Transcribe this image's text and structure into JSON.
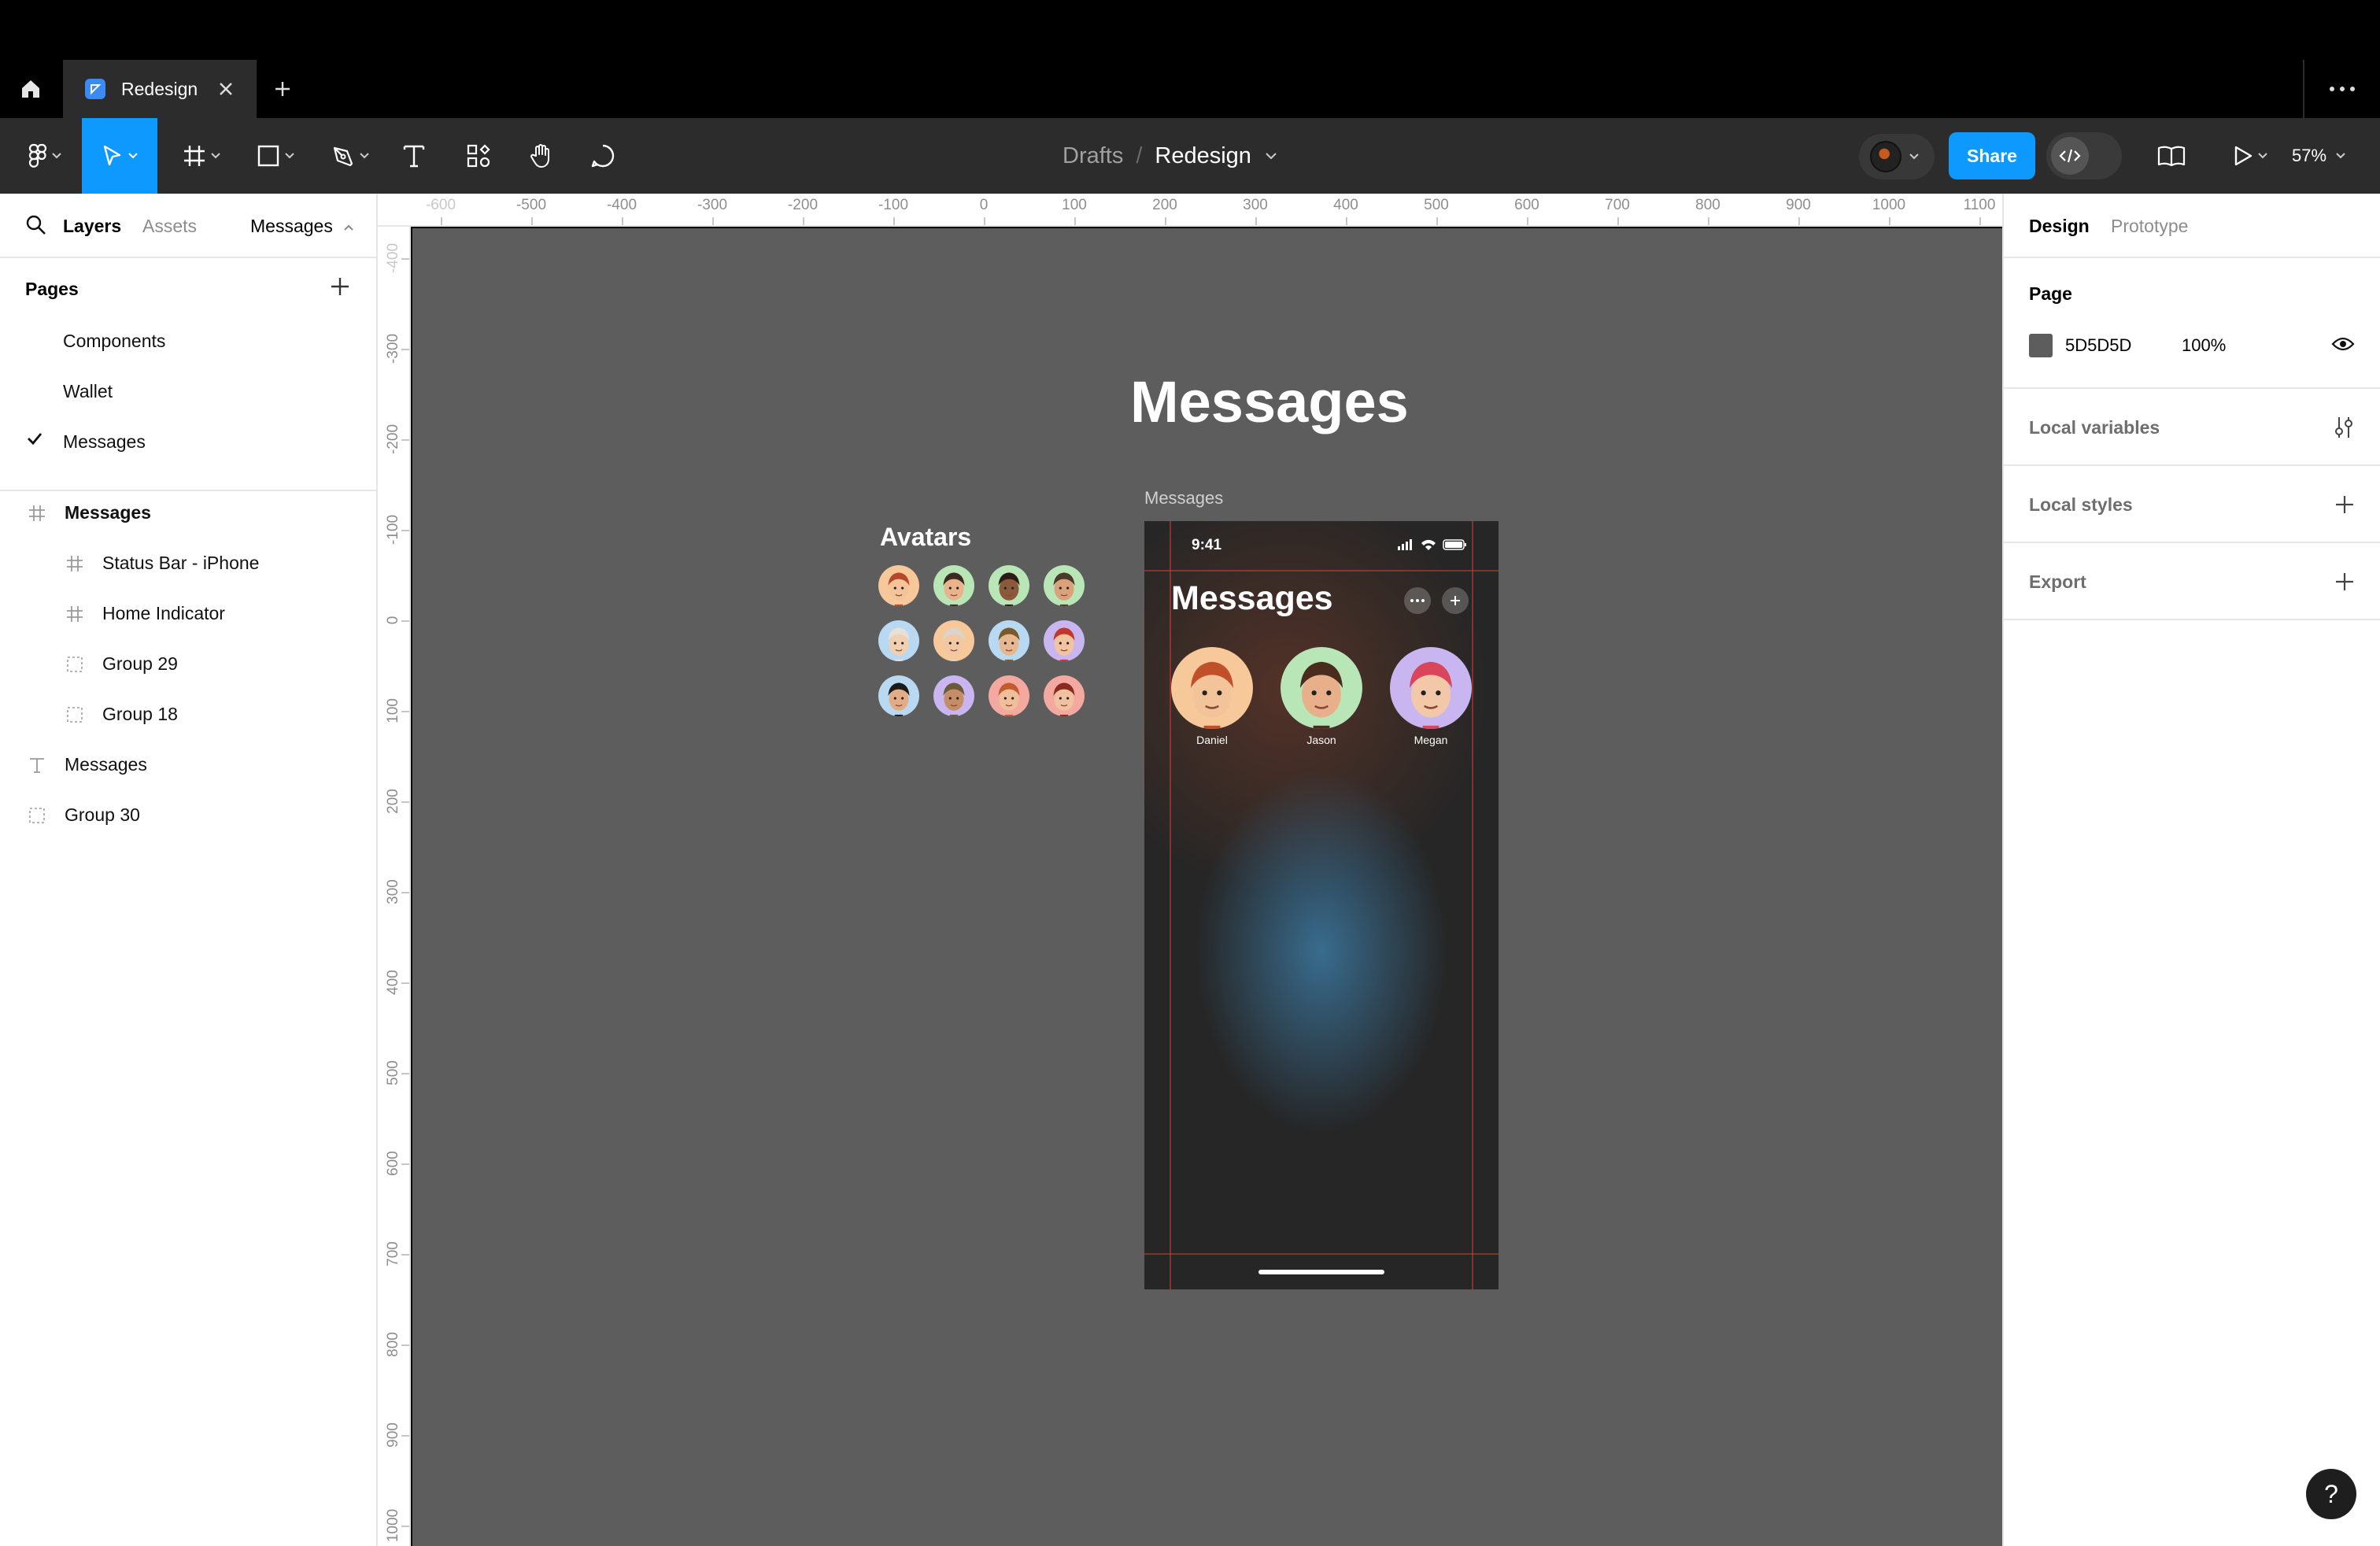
{
  "tabbar": {
    "home_icon": "home-icon",
    "tab_label": "Redesign",
    "new_tab_icon": "plus-icon",
    "more_icon": "ellipsis-icon"
  },
  "toolbar": {
    "breadcrumb_parent": "Drafts",
    "breadcrumb_sep": "/",
    "file_name": "Redesign",
    "share_label": "Share",
    "zoom": "57%"
  },
  "left_panel": {
    "tabs": {
      "layers": "Layers",
      "assets": "Assets",
      "page_switch": "Messages"
    },
    "pages_header": "Pages",
    "pages": [
      {
        "label": "Components",
        "selected": false
      },
      {
        "label": "Wallet",
        "selected": false
      },
      {
        "label": "Messages",
        "selected": true
      }
    ],
    "layers": [
      {
        "label": "Messages",
        "type": "frame",
        "depth": 0,
        "bold": true
      },
      {
        "label": "Status Bar - iPhone",
        "type": "frame",
        "depth": 1
      },
      {
        "label": "Home Indicator",
        "type": "frame",
        "depth": 1
      },
      {
        "label": "Group 29",
        "type": "group",
        "depth": 1
      },
      {
        "label": "Group 18",
        "type": "group",
        "depth": 1
      },
      {
        "label": "Messages",
        "type": "text",
        "depth": 0
      },
      {
        "label": "Group 30",
        "type": "group",
        "depth": 0
      }
    ]
  },
  "rulers": {
    "top": [
      "-600",
      "-500",
      "-400",
      "-300",
      "-200",
      "-100",
      "0",
      "100",
      "200",
      "300",
      "400",
      "500",
      "600",
      "700",
      "800",
      "900",
      "1000",
      "1100"
    ],
    "left": [
      "-400",
      "-300",
      "-200",
      "-100",
      "0",
      "100",
      "200",
      "300",
      "400",
      "500",
      "600",
      "700",
      "800",
      "900",
      "1000"
    ]
  },
  "canvas": {
    "background": "#5D5D5D",
    "title": "Messages",
    "avatars_title": "Avatars",
    "frame_label": "Messages",
    "phone": {
      "time": "9:41",
      "title": "Messages",
      "contacts": [
        {
          "name": "Daniel",
          "bg": "#f6c89a"
        },
        {
          "name": "Jason",
          "bg": "#b8e6b6"
        },
        {
          "name": "Megan",
          "bg": "#c9b6f0"
        }
      ]
    },
    "avatar_colors": [
      "#f6c89a",
      "#b8e6b6",
      "#b8e6b6",
      "#b8e6b6",
      "#b9d9f2",
      "#f6c89a",
      "#b9d9f2",
      "#c9b6f0",
      "#b9d9f2",
      "#c9b6f0",
      "#f4a9a0",
      "#f4a9a0"
    ]
  },
  "right_panel": {
    "tabs": {
      "design": "Design",
      "prototype": "Prototype"
    },
    "page_header": "Page",
    "page_color": "5D5D5D",
    "page_opacity": "100%",
    "local_variables": "Local variables",
    "local_styles": "Local styles",
    "export": "Export"
  },
  "help_label": "?"
}
